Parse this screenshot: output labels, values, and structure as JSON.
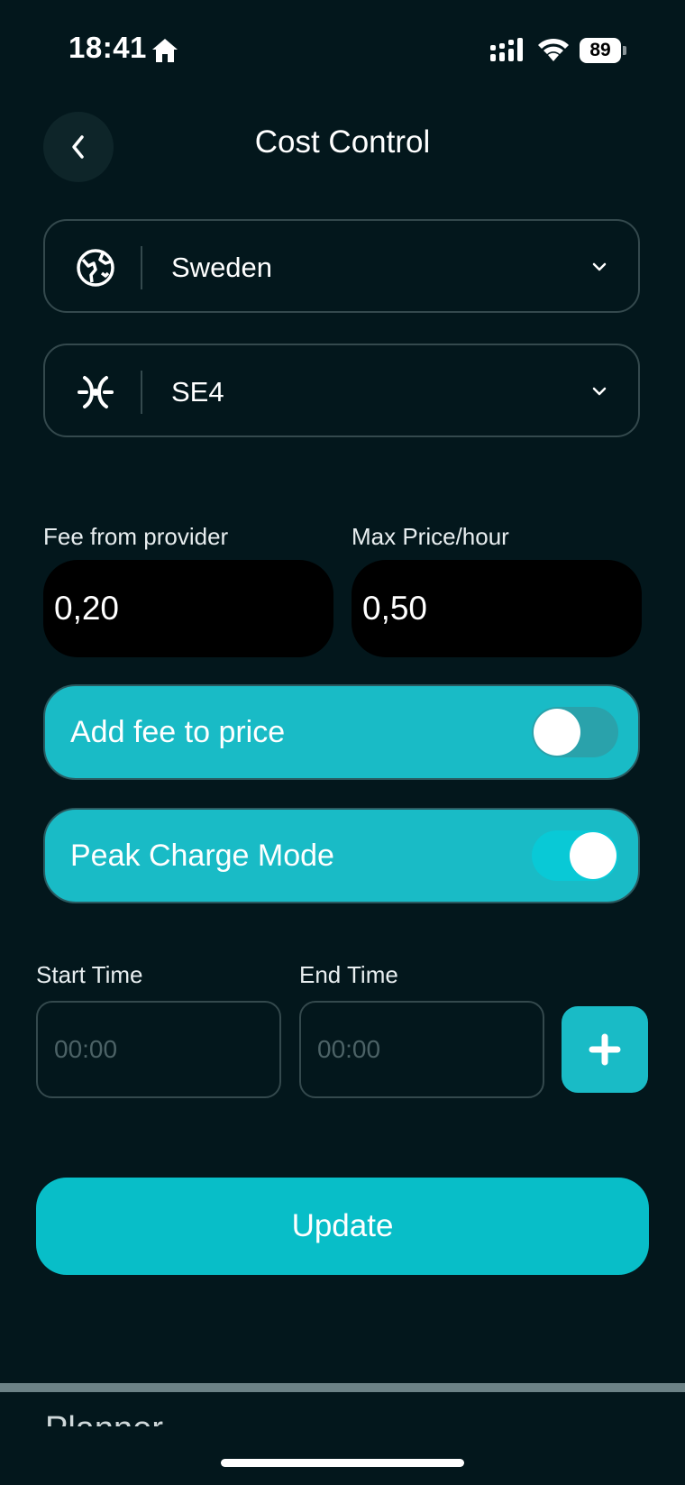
{
  "status_bar": {
    "time": "18:41",
    "battery": "89"
  },
  "header": {
    "title": "Cost Control"
  },
  "selects": {
    "country": {
      "value": "Sweden",
      "icon": "globe-icon"
    },
    "zone": {
      "value": "SE4",
      "icon": "zone-icon"
    }
  },
  "fees": {
    "fee_label": "Fee from provider",
    "fee_value": "0,20",
    "max_label": "Max Price/hour",
    "max_value": "0,50"
  },
  "toggles": {
    "add_fee": {
      "label": "Add fee to price",
      "on": false
    },
    "peak_mode": {
      "label": "Peak Charge Mode",
      "on": true
    }
  },
  "schedule": {
    "start_label": "Start Time",
    "start_placeholder": "00:00",
    "end_label": "End Time",
    "end_placeholder": "00:00"
  },
  "actions": {
    "update_label": "Update"
  },
  "bottom_peek": {
    "label": "Planner"
  },
  "colors": {
    "background": "#03171c",
    "accent": "#19bbc6",
    "input": "#000000"
  }
}
